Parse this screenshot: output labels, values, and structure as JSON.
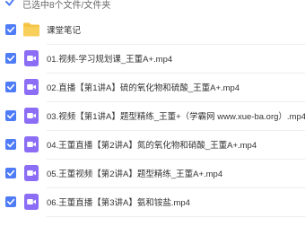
{
  "selection": {
    "count_label": "已选中8个文件/文件夹"
  },
  "colors": {
    "accent": "#4e7bf6",
    "folder": "#f6c344",
    "video": "#8b6ef5"
  },
  "files": [
    {
      "type": "folder",
      "icon": "folder-icon",
      "name": "课堂笔记"
    },
    {
      "type": "video",
      "icon": "video-file-icon",
      "name": "01.视频-学习规划课_王董A+.mp4"
    },
    {
      "type": "video",
      "icon": "video-file-icon",
      "name": "02.直播【第1讲A】硫的氧化物和硫酸_王董A+.mp4"
    },
    {
      "type": "video",
      "icon": "video-file-icon",
      "name": "03.视频【第1讲A】题型精练_王董+（学霸网 www.xue-ba.org）.mp4"
    },
    {
      "type": "video",
      "icon": "video-file-icon",
      "name": "04.王董直播【第2讲A】氮的氧化物和硝酸_王董A+.mp4"
    },
    {
      "type": "video",
      "icon": "video-file-icon",
      "name": "05.王董视频【第2讲A】题型精练_王董A+.mp4"
    },
    {
      "type": "video",
      "icon": "video-file-icon",
      "name": "06.王董直播【第3讲A】氨和铵盐.mp4"
    }
  ]
}
